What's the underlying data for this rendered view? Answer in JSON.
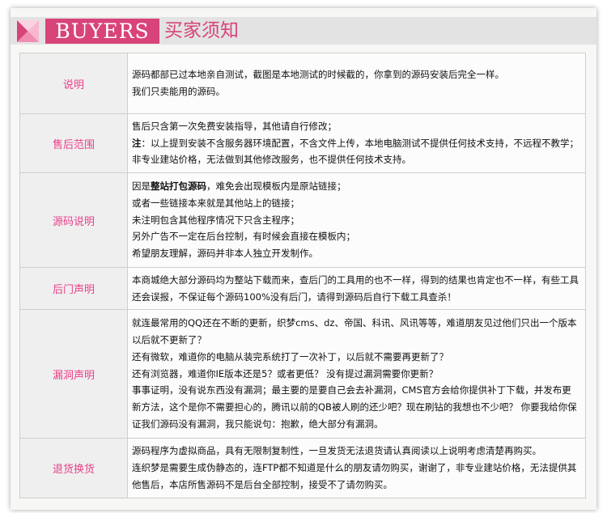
{
  "header": {
    "badge": "BUYERS",
    "title": "买家须知",
    "accent": "#d8437a"
  },
  "rows": [
    {
      "label": "说明",
      "lines": [
        "源码都部已过本地亲自测试，截图是本地测试的时候截的，你拿到的源码安装后完全一样。",
        "我们只卖能用的源码。"
      ]
    },
    {
      "label": "售后范围",
      "line1": "售后只含第一次免费安装指导，其他请自行修改；",
      "note_bold": "注",
      "note_rest": "：以上提到安装不含服务器环境配置，不含文件上传，本地电脑测试不提供任何技术支持，不远程不教学；",
      "line3": "非专业建站价格，无法做到其他修改服务，也不提供任何技术支持。"
    },
    {
      "label": "源码说明",
      "first_pre": "因是",
      "first_bold": "整站打包源码",
      "first_post": "，难免会出现模板内是原站链接；",
      "lines": [
        "或者一些链接本来就是其他站上的链接；",
        "未注明包含其他程序情况下只含主程序；",
        "另外广告不一定在后台控制，有时候会直接在模板内；",
        "希望朋友理解，源码并非本人独立开发制作。"
      ]
    },
    {
      "label": "后门声明",
      "text": "本商城绝大部分源码均为整站下载而来，查后门的工具用的也不一样，得到的结果也肯定也不一样，有些工具还会误报，不保证每个源码100%没有后门，请得到源码后自行下载工具查杀！"
    },
    {
      "label": "漏洞声明",
      "paras": [
        "就连最常用的QQ还在不断的更新，织梦cms、dz、帝国、科讯、风讯等等，难道朋友见过他们只出一个版本以后就不更新了？",
        "还有微软，难道你的电脑从装完系统打了一次补丁，以后就不需要再更新了？",
        "还有浏览器，难道你IE版本还是5？或者更低？ 没有提过漏洞需要你更新？",
        "事事证明，没有说东西没有漏洞；最主要的是要自己会去补漏洞，CMS官方会给你提供补丁下载，并发布更新方法，这个是你不需要担心的，腾讯以前的QB被人刷的还少吧？现在刷钻的我想也不少吧？ 你要我给你保证我们源码没有漏洞，我只能说句：抱歉，绝大部分有漏洞。"
      ]
    },
    {
      "label": "退货换货",
      "paras": [
        "源码程序为虚拟商品，具有无限制复制性，一旦发货无法退货请认真阅读以上说明考虑清楚再购买。",
        "连织梦是需要生成伪静态的，连FTP都不知道是什么的朋友请勿购买，谢谢了，非专业建站价格，无法提供其他售后，本店所售源码不是后台全部控制，接受不了请勿购买。"
      ]
    }
  ]
}
